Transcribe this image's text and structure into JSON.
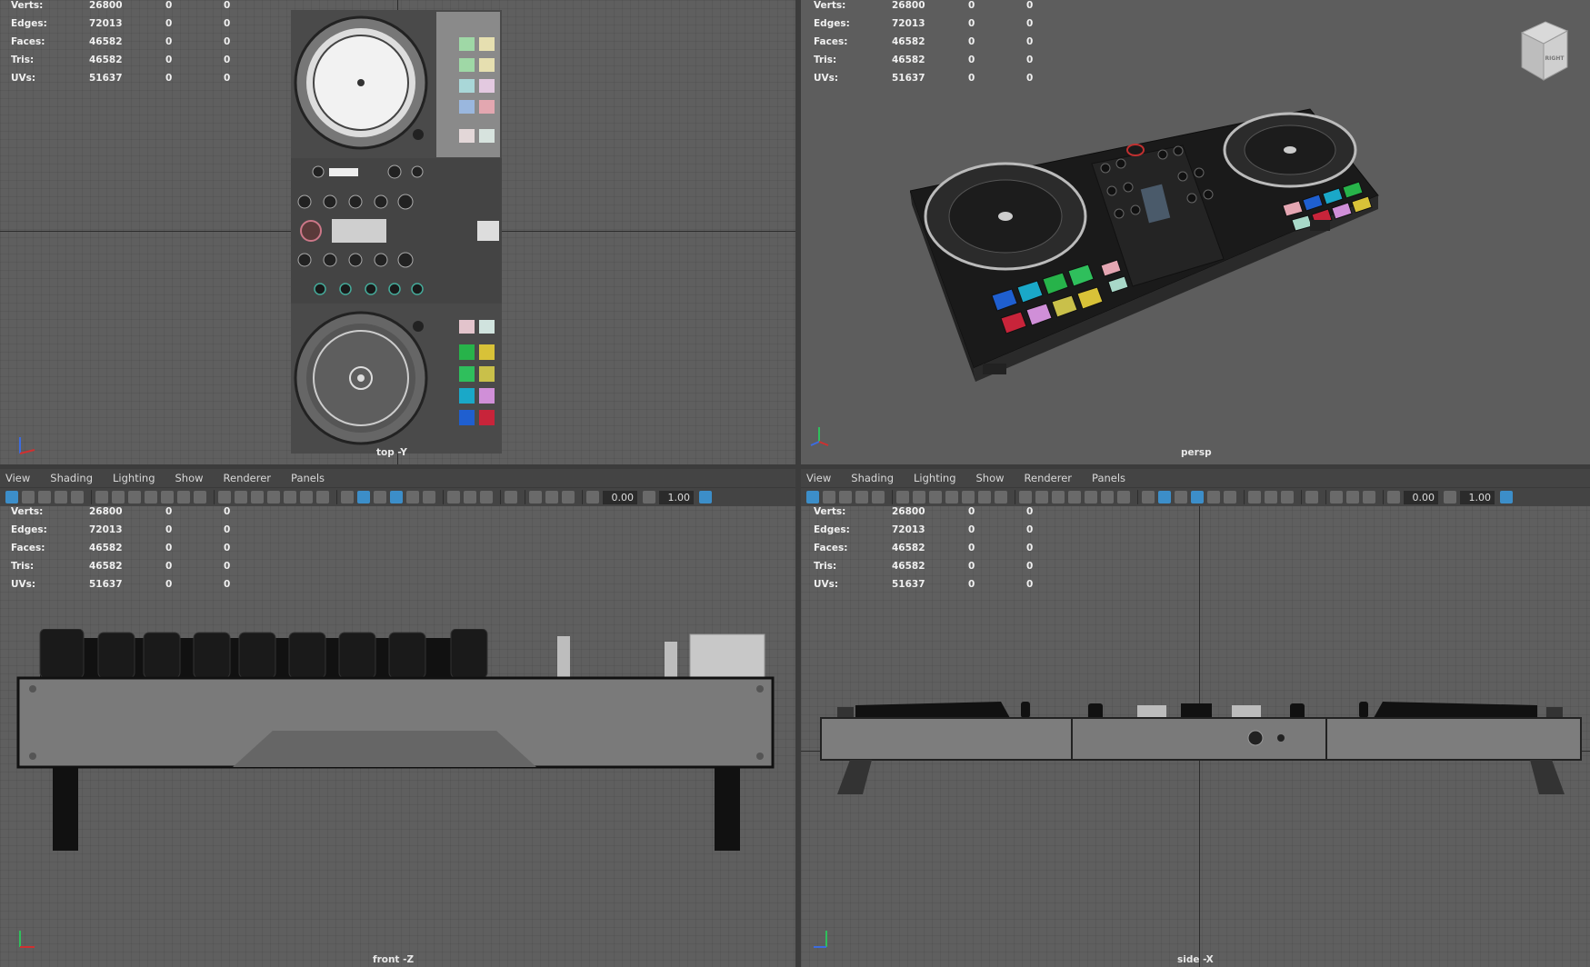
{
  "menu": [
    "View",
    "Shading",
    "Lighting",
    "Show",
    "Renderer",
    "Panels"
  ],
  "hud": {
    "labels": [
      "Verts:",
      "Edges:",
      "Faces:",
      "Tris:",
      "UVs:"
    ],
    "values": [
      "26800",
      "72013",
      "46582",
      "46582",
      "51637"
    ],
    "zeros": [
      "0",
      "0"
    ]
  },
  "toolbar": {
    "field1": "0.00",
    "field2": "1.00"
  },
  "viewports": {
    "top": {
      "camera": "top -Y"
    },
    "persp": {
      "camera": "persp",
      "viewcube_label": "RIGHT"
    },
    "front": {
      "camera": "front -Z"
    },
    "side": {
      "camera": "side -X"
    }
  },
  "pad_colors": [
    "#1f5fd0",
    "#1aa8c8",
    "#27b34a",
    "#2fbf5c",
    "#d8c238",
    "#c8243a",
    "#d08fd8",
    "#c9c04a",
    "#e4a6b2",
    "#a8d8c8"
  ],
  "accent": "#3c8ec9"
}
